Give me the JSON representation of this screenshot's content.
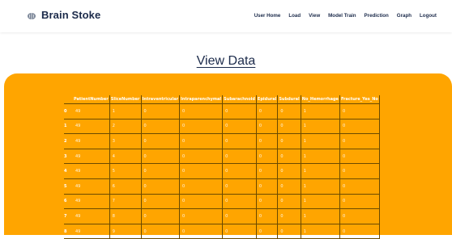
{
  "brand": {
    "name": "Brain Stoke",
    "icon": "brain-icon"
  },
  "nav": [
    {
      "label": "User Home"
    },
    {
      "label": "Load"
    },
    {
      "label": "View"
    },
    {
      "label": "Model Train"
    },
    {
      "label": "Prediction"
    },
    {
      "label": "Graph"
    },
    {
      "label": "Logout"
    }
  ],
  "page_title": "View Data",
  "colors": {
    "panel": "#ffa500",
    "brand_text": "#1b2a4a"
  },
  "table": {
    "headers": [
      "PatientNumber",
      "SliceNumber",
      "Intraventricular",
      "Intraparenchymal",
      "Subarachnoid",
      "Epidural",
      "Subdural",
      "No_Hemorrhage",
      "Fracture_Yes_No"
    ],
    "rows": [
      {
        "index": "0",
        "cells": [
          "49",
          "1",
          "0",
          "0",
          "0",
          "0",
          "0",
          "1",
          "0"
        ]
      },
      {
        "index": "1",
        "cells": [
          "49",
          "2",
          "0",
          "0",
          "0",
          "0",
          "0",
          "1",
          "0"
        ]
      },
      {
        "index": "2",
        "cells": [
          "49",
          "3",
          "0",
          "0",
          "0",
          "0",
          "0",
          "1",
          "0"
        ]
      },
      {
        "index": "3",
        "cells": [
          "49",
          "4",
          "0",
          "0",
          "0",
          "0",
          "0",
          "1",
          "0"
        ]
      },
      {
        "index": "4",
        "cells": [
          "49",
          "5",
          "0",
          "0",
          "0",
          "0",
          "0",
          "1",
          "0"
        ]
      },
      {
        "index": "5",
        "cells": [
          "49",
          "6",
          "0",
          "0",
          "0",
          "0",
          "0",
          "1",
          "0"
        ]
      },
      {
        "index": "6",
        "cells": [
          "49",
          "7",
          "0",
          "0",
          "0",
          "0",
          "0",
          "1",
          "0"
        ]
      },
      {
        "index": "7",
        "cells": [
          "49",
          "8",
          "0",
          "0",
          "0",
          "0",
          "0",
          "1",
          "0"
        ]
      },
      {
        "index": "8",
        "cells": [
          "49",
          "9",
          "0",
          "0",
          "0",
          "0",
          "0",
          "1",
          "0"
        ]
      }
    ]
  }
}
